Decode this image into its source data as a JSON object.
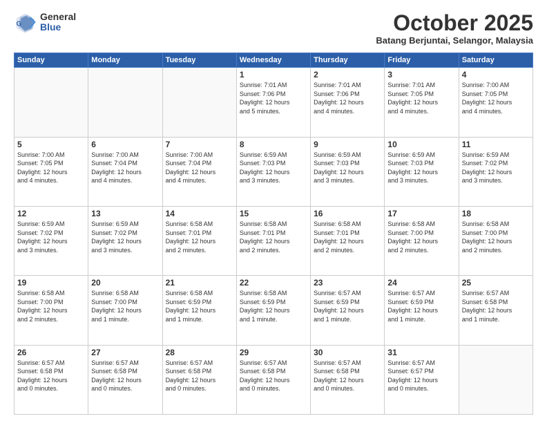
{
  "logo": {
    "general": "General",
    "blue": "Blue"
  },
  "header": {
    "month": "October 2025",
    "location": "Batang Berjuntai, Selangor, Malaysia"
  },
  "weekdays": [
    "Sunday",
    "Monday",
    "Tuesday",
    "Wednesday",
    "Thursday",
    "Friday",
    "Saturday"
  ],
  "weeks": [
    [
      {
        "day": "",
        "info": ""
      },
      {
        "day": "",
        "info": ""
      },
      {
        "day": "",
        "info": ""
      },
      {
        "day": "1",
        "info": "Sunrise: 7:01 AM\nSunset: 7:06 PM\nDaylight: 12 hours\nand 5 minutes."
      },
      {
        "day": "2",
        "info": "Sunrise: 7:01 AM\nSunset: 7:06 PM\nDaylight: 12 hours\nand 4 minutes."
      },
      {
        "day": "3",
        "info": "Sunrise: 7:01 AM\nSunset: 7:05 PM\nDaylight: 12 hours\nand 4 minutes."
      },
      {
        "day": "4",
        "info": "Sunrise: 7:00 AM\nSunset: 7:05 PM\nDaylight: 12 hours\nand 4 minutes."
      }
    ],
    [
      {
        "day": "5",
        "info": "Sunrise: 7:00 AM\nSunset: 7:05 PM\nDaylight: 12 hours\nand 4 minutes."
      },
      {
        "day": "6",
        "info": "Sunrise: 7:00 AM\nSunset: 7:04 PM\nDaylight: 12 hours\nand 4 minutes."
      },
      {
        "day": "7",
        "info": "Sunrise: 7:00 AM\nSunset: 7:04 PM\nDaylight: 12 hours\nand 4 minutes."
      },
      {
        "day": "8",
        "info": "Sunrise: 6:59 AM\nSunset: 7:03 PM\nDaylight: 12 hours\nand 3 minutes."
      },
      {
        "day": "9",
        "info": "Sunrise: 6:59 AM\nSunset: 7:03 PM\nDaylight: 12 hours\nand 3 minutes."
      },
      {
        "day": "10",
        "info": "Sunrise: 6:59 AM\nSunset: 7:03 PM\nDaylight: 12 hours\nand 3 minutes."
      },
      {
        "day": "11",
        "info": "Sunrise: 6:59 AM\nSunset: 7:02 PM\nDaylight: 12 hours\nand 3 minutes."
      }
    ],
    [
      {
        "day": "12",
        "info": "Sunrise: 6:59 AM\nSunset: 7:02 PM\nDaylight: 12 hours\nand 3 minutes."
      },
      {
        "day": "13",
        "info": "Sunrise: 6:59 AM\nSunset: 7:02 PM\nDaylight: 12 hours\nand 3 minutes."
      },
      {
        "day": "14",
        "info": "Sunrise: 6:58 AM\nSunset: 7:01 PM\nDaylight: 12 hours\nand 2 minutes."
      },
      {
        "day": "15",
        "info": "Sunrise: 6:58 AM\nSunset: 7:01 PM\nDaylight: 12 hours\nand 2 minutes."
      },
      {
        "day": "16",
        "info": "Sunrise: 6:58 AM\nSunset: 7:01 PM\nDaylight: 12 hours\nand 2 minutes."
      },
      {
        "day": "17",
        "info": "Sunrise: 6:58 AM\nSunset: 7:00 PM\nDaylight: 12 hours\nand 2 minutes."
      },
      {
        "day": "18",
        "info": "Sunrise: 6:58 AM\nSunset: 7:00 PM\nDaylight: 12 hours\nand 2 minutes."
      }
    ],
    [
      {
        "day": "19",
        "info": "Sunrise: 6:58 AM\nSunset: 7:00 PM\nDaylight: 12 hours\nand 2 minutes."
      },
      {
        "day": "20",
        "info": "Sunrise: 6:58 AM\nSunset: 7:00 PM\nDaylight: 12 hours\nand 1 minute."
      },
      {
        "day": "21",
        "info": "Sunrise: 6:58 AM\nSunset: 6:59 PM\nDaylight: 12 hours\nand 1 minute."
      },
      {
        "day": "22",
        "info": "Sunrise: 6:58 AM\nSunset: 6:59 PM\nDaylight: 12 hours\nand 1 minute."
      },
      {
        "day": "23",
        "info": "Sunrise: 6:57 AM\nSunset: 6:59 PM\nDaylight: 12 hours\nand 1 minute."
      },
      {
        "day": "24",
        "info": "Sunrise: 6:57 AM\nSunset: 6:59 PM\nDaylight: 12 hours\nand 1 minute."
      },
      {
        "day": "25",
        "info": "Sunrise: 6:57 AM\nSunset: 6:58 PM\nDaylight: 12 hours\nand 1 minute."
      }
    ],
    [
      {
        "day": "26",
        "info": "Sunrise: 6:57 AM\nSunset: 6:58 PM\nDaylight: 12 hours\nand 0 minutes."
      },
      {
        "day": "27",
        "info": "Sunrise: 6:57 AM\nSunset: 6:58 PM\nDaylight: 12 hours\nand 0 minutes."
      },
      {
        "day": "28",
        "info": "Sunrise: 6:57 AM\nSunset: 6:58 PM\nDaylight: 12 hours\nand 0 minutes."
      },
      {
        "day": "29",
        "info": "Sunrise: 6:57 AM\nSunset: 6:58 PM\nDaylight: 12 hours\nand 0 minutes."
      },
      {
        "day": "30",
        "info": "Sunrise: 6:57 AM\nSunset: 6:58 PM\nDaylight: 12 hours\nand 0 minutes."
      },
      {
        "day": "31",
        "info": "Sunrise: 6:57 AM\nSunset: 6:57 PM\nDaylight: 12 hours\nand 0 minutes."
      },
      {
        "day": "",
        "info": ""
      }
    ]
  ]
}
